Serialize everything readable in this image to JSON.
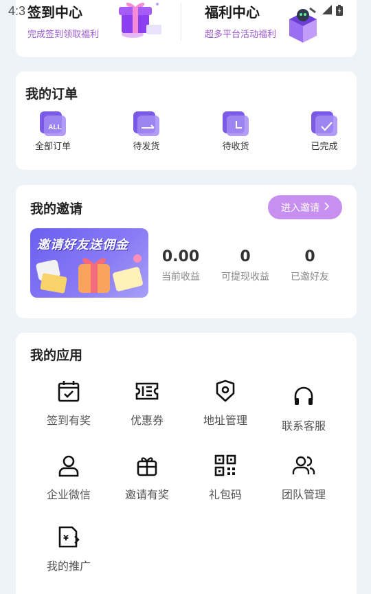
{
  "status_bar": {
    "time": "4:3"
  },
  "welfare": [
    {
      "title": "签到中心",
      "subtitle": "完成签到领取福利"
    },
    {
      "title": "福利中心",
      "subtitle": "超多平台活动福利"
    }
  ],
  "orders": {
    "title": "我的订单",
    "items": [
      {
        "label": "全部订单",
        "icon": "all-orders-icon",
        "badge": "ALL"
      },
      {
        "label": "待发货",
        "icon": "to-ship-icon"
      },
      {
        "label": "待收货",
        "icon": "to-receive-icon"
      },
      {
        "label": "已完成",
        "icon": "completed-icon"
      }
    ]
  },
  "invite": {
    "title": "我的邀请",
    "button": "进入邀请",
    "banner_text": "邀请好友送佣金",
    "stats": [
      {
        "value": "0.00",
        "label": "当前收益"
      },
      {
        "value": "0",
        "label": "可提现收益"
      },
      {
        "value": "0",
        "label": "已邀好友"
      }
    ]
  },
  "apps": {
    "title": "我的应用",
    "items": [
      {
        "label": "签到有奖",
        "icon": "calendar-check-icon"
      },
      {
        "label": "优惠券",
        "icon": "coupon-icon"
      },
      {
        "label": "地址管理",
        "icon": "location-icon"
      },
      {
        "label": "联系客服",
        "icon": "headset-icon"
      },
      {
        "label": "企业微信",
        "icon": "user-icon"
      },
      {
        "label": "邀请有奖",
        "icon": "gift-icon"
      },
      {
        "label": "礼包码",
        "icon": "qr-code-icon"
      },
      {
        "label": "团队管理",
        "icon": "team-icon"
      },
      {
        "label": "我的推广",
        "icon": "promotion-icon"
      }
    ]
  },
  "colors": {
    "accent": "#9b59d0",
    "invite_button": "#c790f0",
    "order_icon": "#7b5be6"
  }
}
